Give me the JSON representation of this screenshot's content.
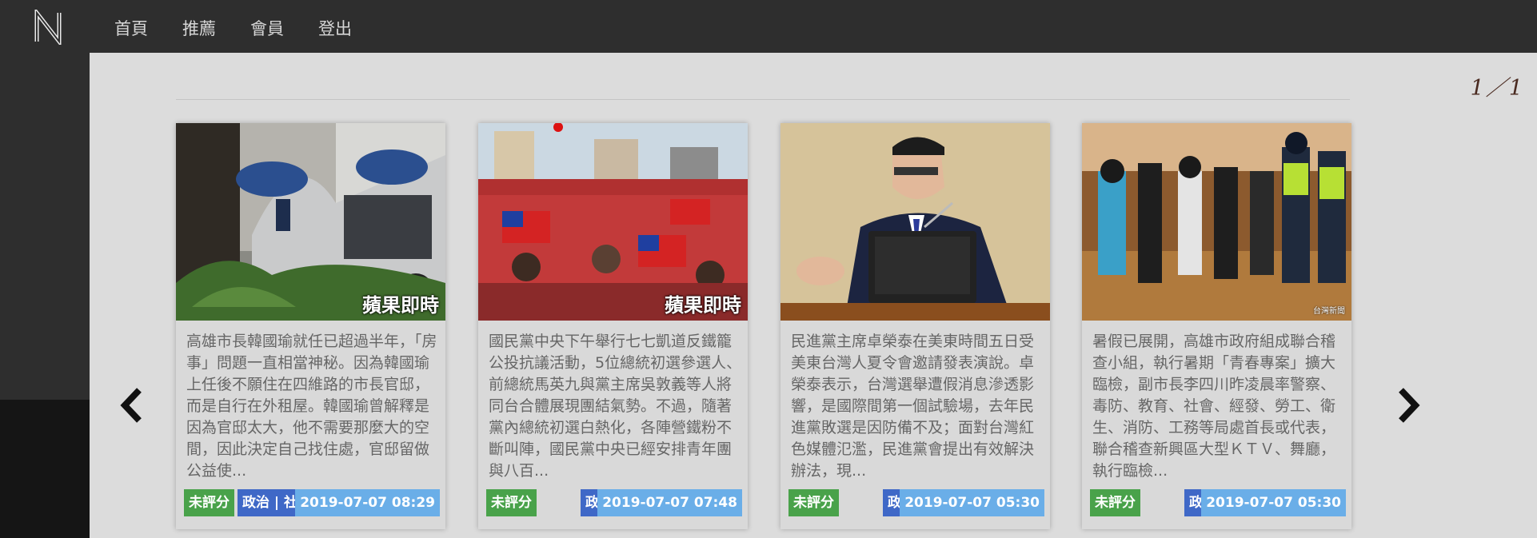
{
  "nav": {
    "logo": "N",
    "items": [
      "首頁",
      "推薦",
      "會員",
      "登出"
    ]
  },
  "pager": "1／1",
  "cards": [
    {
      "image_alt": "Man holding umbrella beside white car",
      "watermark": "蘋果即時",
      "text": "高雄市長韓國瑜就任已超過半年，「房事」問題一直相當神秘。因為韓國瑜上任後不願住在四維路的市長官邸，而是自行在外租屋。韓國瑜曾解釋是因為官邸太大，他不需要那麼大的空間，因此決定自己找住處，官邸留做公益使...",
      "rating": "未評分",
      "category": "政治 | 社會",
      "datetime": "2019-07-07 08:29"
    },
    {
      "image_alt": "Crowd waving flags at rally",
      "watermark": "蘋果即時",
      "text": "國民黨中央下午舉行七七凱道反鐵籠公投抗議活動，5位總統初選參選人、前總統馬英九與黨主席吳敦義等人將同台合體展現團結氣勢。不過，隨著黨內總統初選白熱化，各陣營鐵粉不斷叫陣，國民黨中央已經安排青年團與八百...",
      "rating": "未評分",
      "category": "政治",
      "datetime": "2019-07-07 07:48"
    },
    {
      "image_alt": "Official speaking at podium with microphone",
      "watermark": "",
      "text": "民進黨主席卓榮泰在美東時間五日受美東台灣人夏令會邀請發表演說。卓榮泰表示，台灣選舉遭假消息滲透影響，是國際間第一個試驗場，去年民進黨敗選是因防備不及；面對台灣紅色媒體氾濫，民進黨會提出有效解決辦法，現...",
      "rating": "未評分",
      "category": "政治",
      "datetime": "2019-07-07 05:30"
    },
    {
      "image_alt": "Police inspecting venue with women in line",
      "watermark": "台灣新聞",
      "text": "暑假已展開，高雄市政府組成聯合稽查小組，執行暑期「青春專案」擴大臨檢，副市長李四川昨凌晨率警察、毒防、教育、社會、經發、勞工、衛生、消防、工務等局處首長或代表，聯合稽查新興區大型ＫＴＶ、舞廳，執行臨檢...",
      "rating": "未評分",
      "category": "政治",
      "datetime": "2019-07-07 05:30"
    }
  ],
  "colors": {
    "navbar": "#2e2e2e",
    "background": "#dcdcdc",
    "tag_rating": "#49a24a",
    "tag_category": "#3f68c7",
    "tag_date": "#6aaee8"
  },
  "icons": {
    "prev": "chevron-left-icon",
    "next": "chevron-right-icon"
  }
}
